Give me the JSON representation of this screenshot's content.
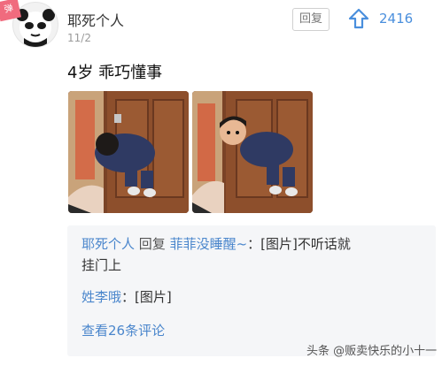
{
  "comment": {
    "author": "耶死个人",
    "date": "11/2",
    "reply_button": "回复",
    "likes": "2416",
    "text": "4岁 乖巧懂事"
  },
  "replies": [
    {
      "author": "耶死个人",
      "reply_word": "回复",
      "target": "菲菲没睡醒~",
      "text": "：[图片]不听话就",
      "text_cont": "挂门上"
    },
    {
      "author": "姓李哦",
      "text": "：[图片]"
    }
  ],
  "more_comments": "查看26条评论",
  "watermark": "头条 @贩卖快乐的小十一",
  "colors": {
    "link": "#4a86cc",
    "likes": "#4a8fdd",
    "reply_bg": "#f5f6f8"
  }
}
